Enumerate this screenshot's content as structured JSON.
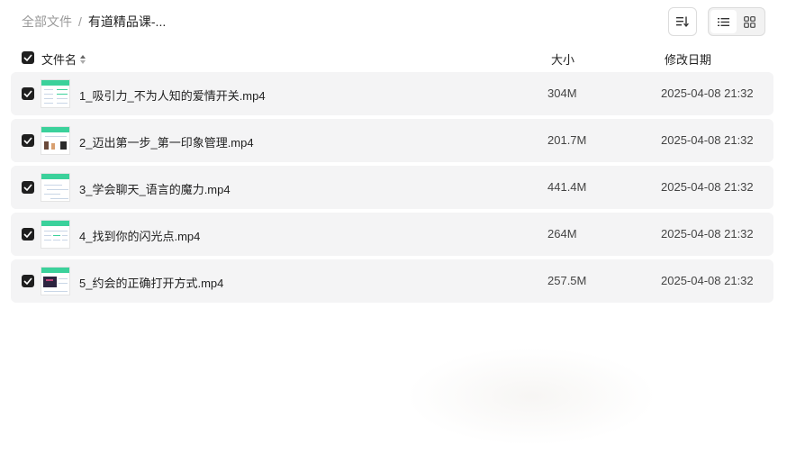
{
  "breadcrumb": {
    "root": "全部文件",
    "separator": "/",
    "current": "有道精品课-..."
  },
  "toolbar": {
    "sort_icon": "sort-icon",
    "list_view_icon": "list-view-icon",
    "grid_view_icon": "grid-view-icon",
    "active_view": "list"
  },
  "table": {
    "columns": {
      "name": "文件名",
      "size": "大小",
      "date": "修改日期"
    },
    "rows": [
      {
        "name": "1_吸引力_不为人知的爱情开关.mp4",
        "size": "304M",
        "date": "2025-04-08 21:32",
        "checked": true
      },
      {
        "name": "2_迈出第一步_第一印象管理.mp4",
        "size": "201.7M",
        "date": "2025-04-08 21:32",
        "checked": true
      },
      {
        "name": "3_学会聊天_语言的魔力.mp4",
        "size": "441.4M",
        "date": "2025-04-08 21:32",
        "checked": true
      },
      {
        "name": "4_找到你的闪光点.mp4",
        "size": "264M",
        "date": "2025-04-08 21:32",
        "checked": true
      },
      {
        "name": "5_约会的正确打开方式.mp4",
        "size": "257.5M",
        "date": "2025-04-08 21:32",
        "checked": true
      }
    ]
  },
  "colors": {
    "checkbox": "#1f1f1f",
    "row_bg": "#f4f4f5",
    "thumb_accent": "#3bd19b"
  }
}
